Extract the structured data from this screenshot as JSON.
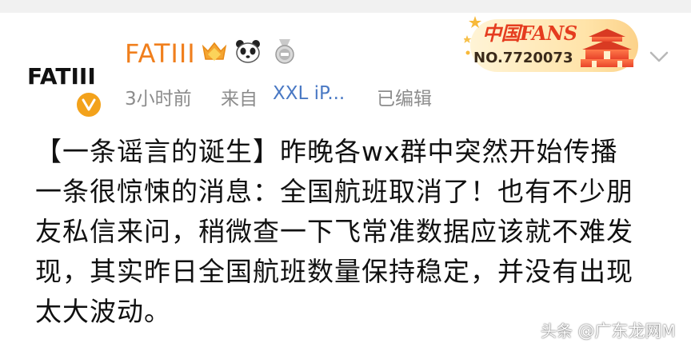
{
  "post": {
    "author": {
      "avatar_text": "FATIII",
      "name": "FATIII",
      "badges": [
        "crown-badge-icon",
        "panda-badge-icon",
        "medal-badge-icon"
      ]
    },
    "meta": {
      "time": "3小时前",
      "from": "来自",
      "device": "XXL iP...",
      "edited": "已编辑"
    },
    "fans_card": {
      "title": "中国FANS",
      "number": "NO.7720073"
    },
    "content_lines": [
      "【一条谣言的诞生】昨晚各wx群中突然开始传播",
      "一条很惊悚的消息：全国航班取消了！也有不少朋",
      "友私信来问，稍微查一下飞常准数据应该就不难发",
      "现，其实昨日全国航班数量保持稳定，并没有出现",
      "太大波动。"
    ]
  },
  "watermark": {
    "prefix": "头条",
    "site": "@广东龙网",
    "tail": "M"
  },
  "colors": {
    "username": "#f07f1d",
    "device_link": "#4a79c4",
    "meta": "#8c8c8c",
    "verify": "#f3a21b",
    "fans_red": "#e53c1f"
  }
}
